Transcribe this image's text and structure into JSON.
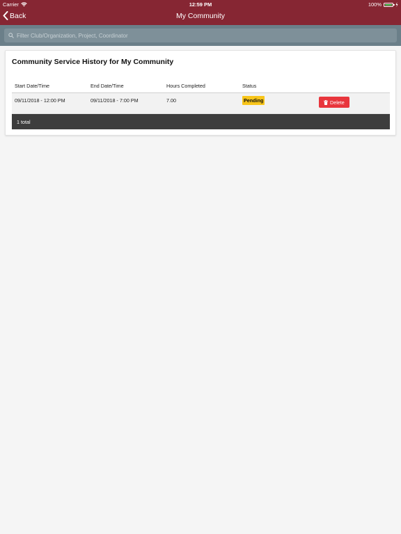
{
  "status_bar": {
    "carrier": "Carrier",
    "time": "12:59 PM",
    "battery": "100%"
  },
  "nav": {
    "back_label": "Back",
    "title": "My Community"
  },
  "search": {
    "placeholder": "Filter Club/Organization, Project, Coordinator"
  },
  "card": {
    "title": "Community Service History for My Community"
  },
  "table": {
    "headers": [
      "Start Date/Time",
      "End Date/Time",
      "Hours Completed",
      "Status"
    ],
    "rows": [
      {
        "start": "09/11/2018 - 12:00 PM",
        "end": "09/11/2018 - 7:00 PM",
        "hours": "7.00",
        "status": "Pending",
        "action": "Delete"
      }
    ],
    "footer": "1 total"
  },
  "colors": {
    "header_bg": "#862633",
    "search_bg": "#6b7f89",
    "pending": "#f8c51a",
    "delete": "#e8363d",
    "footer_bg": "#3d3d3d"
  },
  "icons": {
    "wifi": "wifi-icon",
    "battery": "battery-icon",
    "charging": "charging-icon",
    "back": "chevron-left-icon",
    "search": "search-icon",
    "trash": "trash-icon"
  }
}
